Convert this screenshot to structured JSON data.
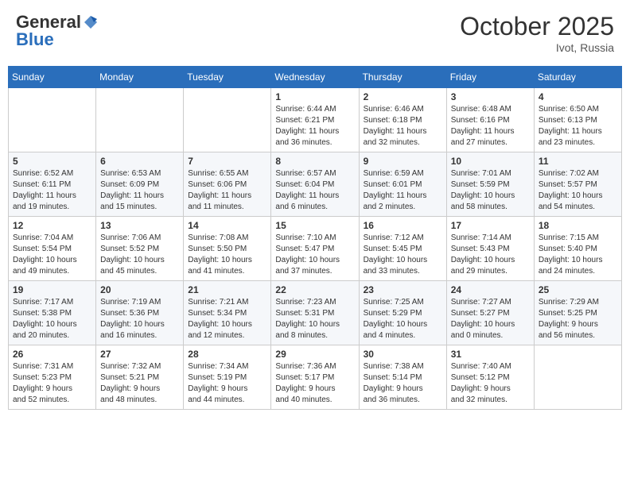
{
  "header": {
    "logo_general": "General",
    "logo_blue": "Blue",
    "month": "October 2025",
    "location": "Ivot, Russia"
  },
  "days_of_week": [
    "Sunday",
    "Monday",
    "Tuesday",
    "Wednesday",
    "Thursday",
    "Friday",
    "Saturday"
  ],
  "weeks": [
    [
      {
        "day": "",
        "info": ""
      },
      {
        "day": "",
        "info": ""
      },
      {
        "day": "",
        "info": ""
      },
      {
        "day": "1",
        "info": "Sunrise: 6:44 AM\nSunset: 6:21 PM\nDaylight: 11 hours\nand 36 minutes."
      },
      {
        "day": "2",
        "info": "Sunrise: 6:46 AM\nSunset: 6:18 PM\nDaylight: 11 hours\nand 32 minutes."
      },
      {
        "day": "3",
        "info": "Sunrise: 6:48 AM\nSunset: 6:16 PM\nDaylight: 11 hours\nand 27 minutes."
      },
      {
        "day": "4",
        "info": "Sunrise: 6:50 AM\nSunset: 6:13 PM\nDaylight: 11 hours\nand 23 minutes."
      }
    ],
    [
      {
        "day": "5",
        "info": "Sunrise: 6:52 AM\nSunset: 6:11 PM\nDaylight: 11 hours\nand 19 minutes."
      },
      {
        "day": "6",
        "info": "Sunrise: 6:53 AM\nSunset: 6:09 PM\nDaylight: 11 hours\nand 15 minutes."
      },
      {
        "day": "7",
        "info": "Sunrise: 6:55 AM\nSunset: 6:06 PM\nDaylight: 11 hours\nand 11 minutes."
      },
      {
        "day": "8",
        "info": "Sunrise: 6:57 AM\nSunset: 6:04 PM\nDaylight: 11 hours\nand 6 minutes."
      },
      {
        "day": "9",
        "info": "Sunrise: 6:59 AM\nSunset: 6:01 PM\nDaylight: 11 hours\nand 2 minutes."
      },
      {
        "day": "10",
        "info": "Sunrise: 7:01 AM\nSunset: 5:59 PM\nDaylight: 10 hours\nand 58 minutes."
      },
      {
        "day": "11",
        "info": "Sunrise: 7:02 AM\nSunset: 5:57 PM\nDaylight: 10 hours\nand 54 minutes."
      }
    ],
    [
      {
        "day": "12",
        "info": "Sunrise: 7:04 AM\nSunset: 5:54 PM\nDaylight: 10 hours\nand 49 minutes."
      },
      {
        "day": "13",
        "info": "Sunrise: 7:06 AM\nSunset: 5:52 PM\nDaylight: 10 hours\nand 45 minutes."
      },
      {
        "day": "14",
        "info": "Sunrise: 7:08 AM\nSunset: 5:50 PM\nDaylight: 10 hours\nand 41 minutes."
      },
      {
        "day": "15",
        "info": "Sunrise: 7:10 AM\nSunset: 5:47 PM\nDaylight: 10 hours\nand 37 minutes."
      },
      {
        "day": "16",
        "info": "Sunrise: 7:12 AM\nSunset: 5:45 PM\nDaylight: 10 hours\nand 33 minutes."
      },
      {
        "day": "17",
        "info": "Sunrise: 7:14 AM\nSunset: 5:43 PM\nDaylight: 10 hours\nand 29 minutes."
      },
      {
        "day": "18",
        "info": "Sunrise: 7:15 AM\nSunset: 5:40 PM\nDaylight: 10 hours\nand 24 minutes."
      }
    ],
    [
      {
        "day": "19",
        "info": "Sunrise: 7:17 AM\nSunset: 5:38 PM\nDaylight: 10 hours\nand 20 minutes."
      },
      {
        "day": "20",
        "info": "Sunrise: 7:19 AM\nSunset: 5:36 PM\nDaylight: 10 hours\nand 16 minutes."
      },
      {
        "day": "21",
        "info": "Sunrise: 7:21 AM\nSunset: 5:34 PM\nDaylight: 10 hours\nand 12 minutes."
      },
      {
        "day": "22",
        "info": "Sunrise: 7:23 AM\nSunset: 5:31 PM\nDaylight: 10 hours\nand 8 minutes."
      },
      {
        "day": "23",
        "info": "Sunrise: 7:25 AM\nSunset: 5:29 PM\nDaylight: 10 hours\nand 4 minutes."
      },
      {
        "day": "24",
        "info": "Sunrise: 7:27 AM\nSunset: 5:27 PM\nDaylight: 10 hours\nand 0 minutes."
      },
      {
        "day": "25",
        "info": "Sunrise: 7:29 AM\nSunset: 5:25 PM\nDaylight: 9 hours\nand 56 minutes."
      }
    ],
    [
      {
        "day": "26",
        "info": "Sunrise: 7:31 AM\nSunset: 5:23 PM\nDaylight: 9 hours\nand 52 minutes."
      },
      {
        "day": "27",
        "info": "Sunrise: 7:32 AM\nSunset: 5:21 PM\nDaylight: 9 hours\nand 48 minutes."
      },
      {
        "day": "28",
        "info": "Sunrise: 7:34 AM\nSunset: 5:19 PM\nDaylight: 9 hours\nand 44 minutes."
      },
      {
        "day": "29",
        "info": "Sunrise: 7:36 AM\nSunset: 5:17 PM\nDaylight: 9 hours\nand 40 minutes."
      },
      {
        "day": "30",
        "info": "Sunrise: 7:38 AM\nSunset: 5:14 PM\nDaylight: 9 hours\nand 36 minutes."
      },
      {
        "day": "31",
        "info": "Sunrise: 7:40 AM\nSunset: 5:12 PM\nDaylight: 9 hours\nand 32 minutes."
      },
      {
        "day": "",
        "info": ""
      }
    ]
  ]
}
